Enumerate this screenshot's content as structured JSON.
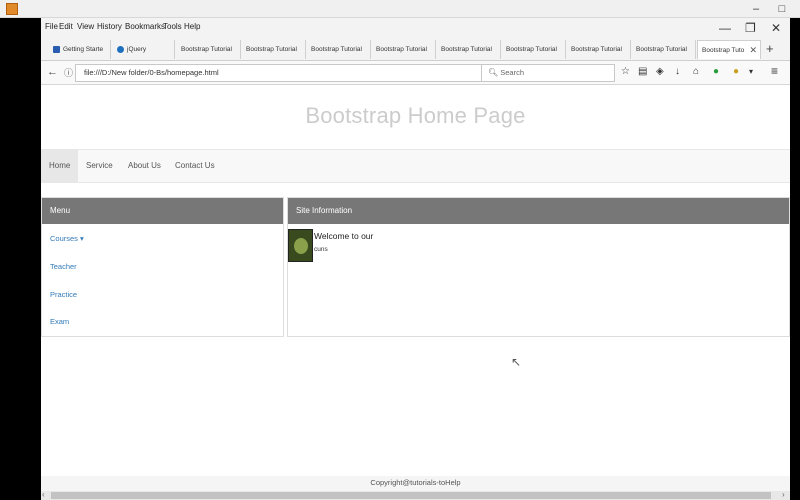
{
  "window": {
    "min_label": "–",
    "max_label": "□"
  },
  "menubar": {
    "items": [
      "File",
      "Edit",
      "View",
      "History",
      "Bookmarks",
      "Tools",
      "Help"
    ],
    "min_label": "—",
    "restore_label": "❐",
    "close_label": "✕"
  },
  "tabs": [
    {
      "label": "Getting Starte",
      "color": "#2a5db0"
    },
    {
      "label": "jQuery",
      "color": "#1e6fbd"
    },
    {
      "label": "Bootstrap Tutorial",
      "color": ""
    },
    {
      "label": "Bootstrap Tutorial",
      "color": ""
    },
    {
      "label": "Bootstrap Tutorial",
      "color": ""
    },
    {
      "label": "Bootstrap Tutorial",
      "color": ""
    },
    {
      "label": "Bootstrap Tutorial",
      "color": ""
    },
    {
      "label": "Bootstrap Tutorial",
      "color": ""
    },
    {
      "label": "Bootstrap Tutorial",
      "color": ""
    },
    {
      "label": "Bootstrap Tutorial",
      "color": ""
    },
    {
      "label": "Bootstrap Tuto",
      "color": "",
      "active": true
    }
  ],
  "tab_close": "✕",
  "new_tab": "+",
  "nav": {
    "back": "←",
    "info": "ⓘ",
    "url": "file:///D:/New folder/0-Bs/homepage.html",
    "reload": "C",
    "search_placeholder": "Search",
    "toolbar_icons": [
      "☆",
      "▤",
      "◈",
      "↓",
      "⌂",
      "●",
      "●",
      "▾",
      "≡"
    ]
  },
  "page": {
    "title": "Bootstrap Home Page",
    "nav_items": [
      "Home",
      "Service",
      "About Us",
      "Contact Us"
    ],
    "menu_panel": {
      "heading": "Menu",
      "items": [
        "Courses ▾",
        "Teacher",
        "Practice",
        "Exam"
      ]
    },
    "site_panel": {
      "heading": "Site Information",
      "welcome_title": "Welcome to our",
      "welcome_sub": "cuns"
    },
    "footer": "Copyright@tutorials-toHelp"
  },
  "colors": {
    "panel_heading": "#777777",
    "link": "#337ab7",
    "active_nav": "#e7e7e7"
  }
}
